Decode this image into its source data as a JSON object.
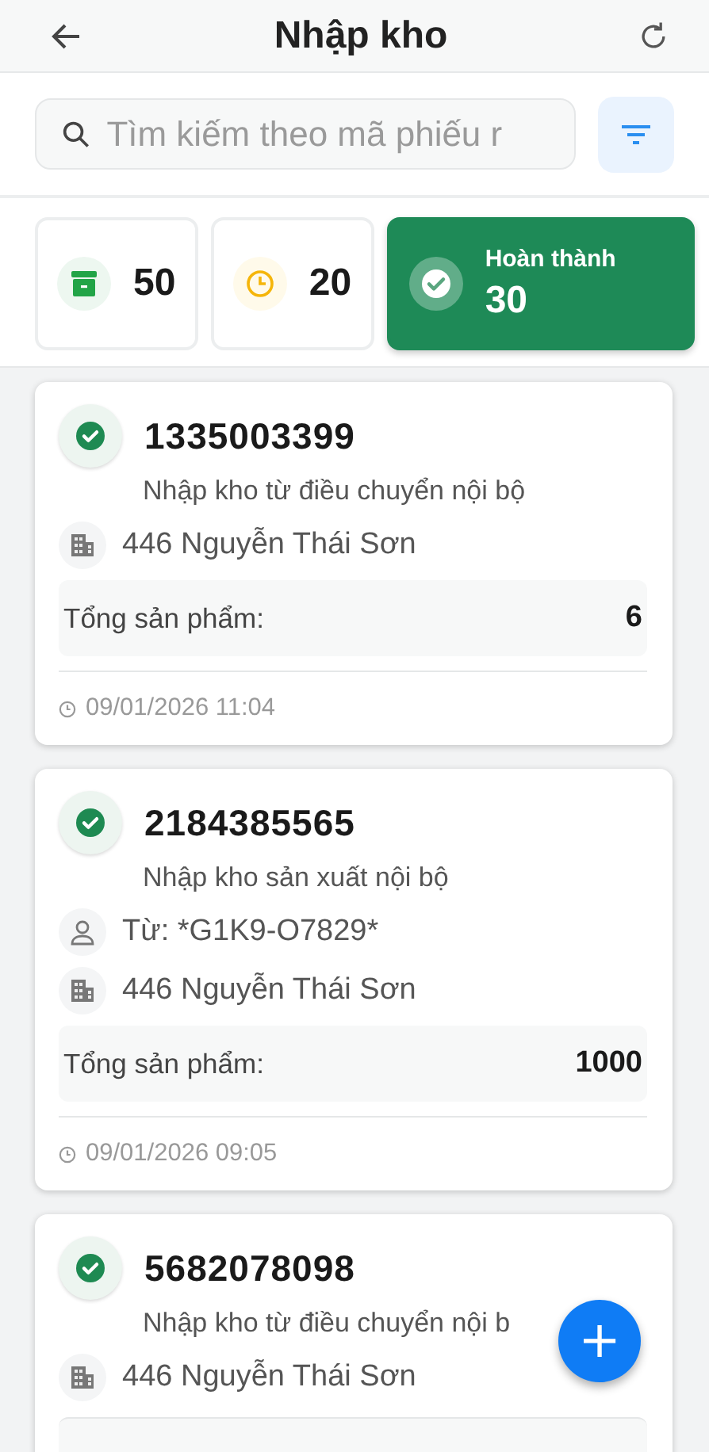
{
  "header": {
    "title": "Nhập kho"
  },
  "search": {
    "placeholder": "Tìm kiếm theo mã phiếu r"
  },
  "stats": [
    {
      "kind": "all",
      "count": "50",
      "selected": false
    },
    {
      "kind": "pending",
      "count": "20",
      "selected": false
    },
    {
      "kind": "done",
      "label": "Hoàn thành",
      "count": "30",
      "selected": true
    }
  ],
  "receipts": [
    {
      "completed": true,
      "code": "1335003399",
      "type": "Nhập kho từ điều chuyển nội bộ",
      "warehouse": "446 Nguyễn Thái Sơn",
      "total_label": "Tổng sản phẩm:",
      "total": "6",
      "time": "09/01/2026 11:04"
    },
    {
      "completed": true,
      "code": "2184385565",
      "type": "Nhập kho sản xuất nội bộ",
      "from": "Từ: *G1K9-O7829*",
      "warehouse": "446 Nguyễn Thái Sơn",
      "total_label": "Tổng sản phẩm:",
      "total": "1000",
      "time": "09/01/2026 09:05"
    },
    {
      "completed": true,
      "code": "5682078098",
      "type": "Nhập kho từ điều chuyển nội b",
      "warehouse": "446 Nguyễn Thái Sơn"
    }
  ],
  "fab": {
    "label": "+"
  }
}
